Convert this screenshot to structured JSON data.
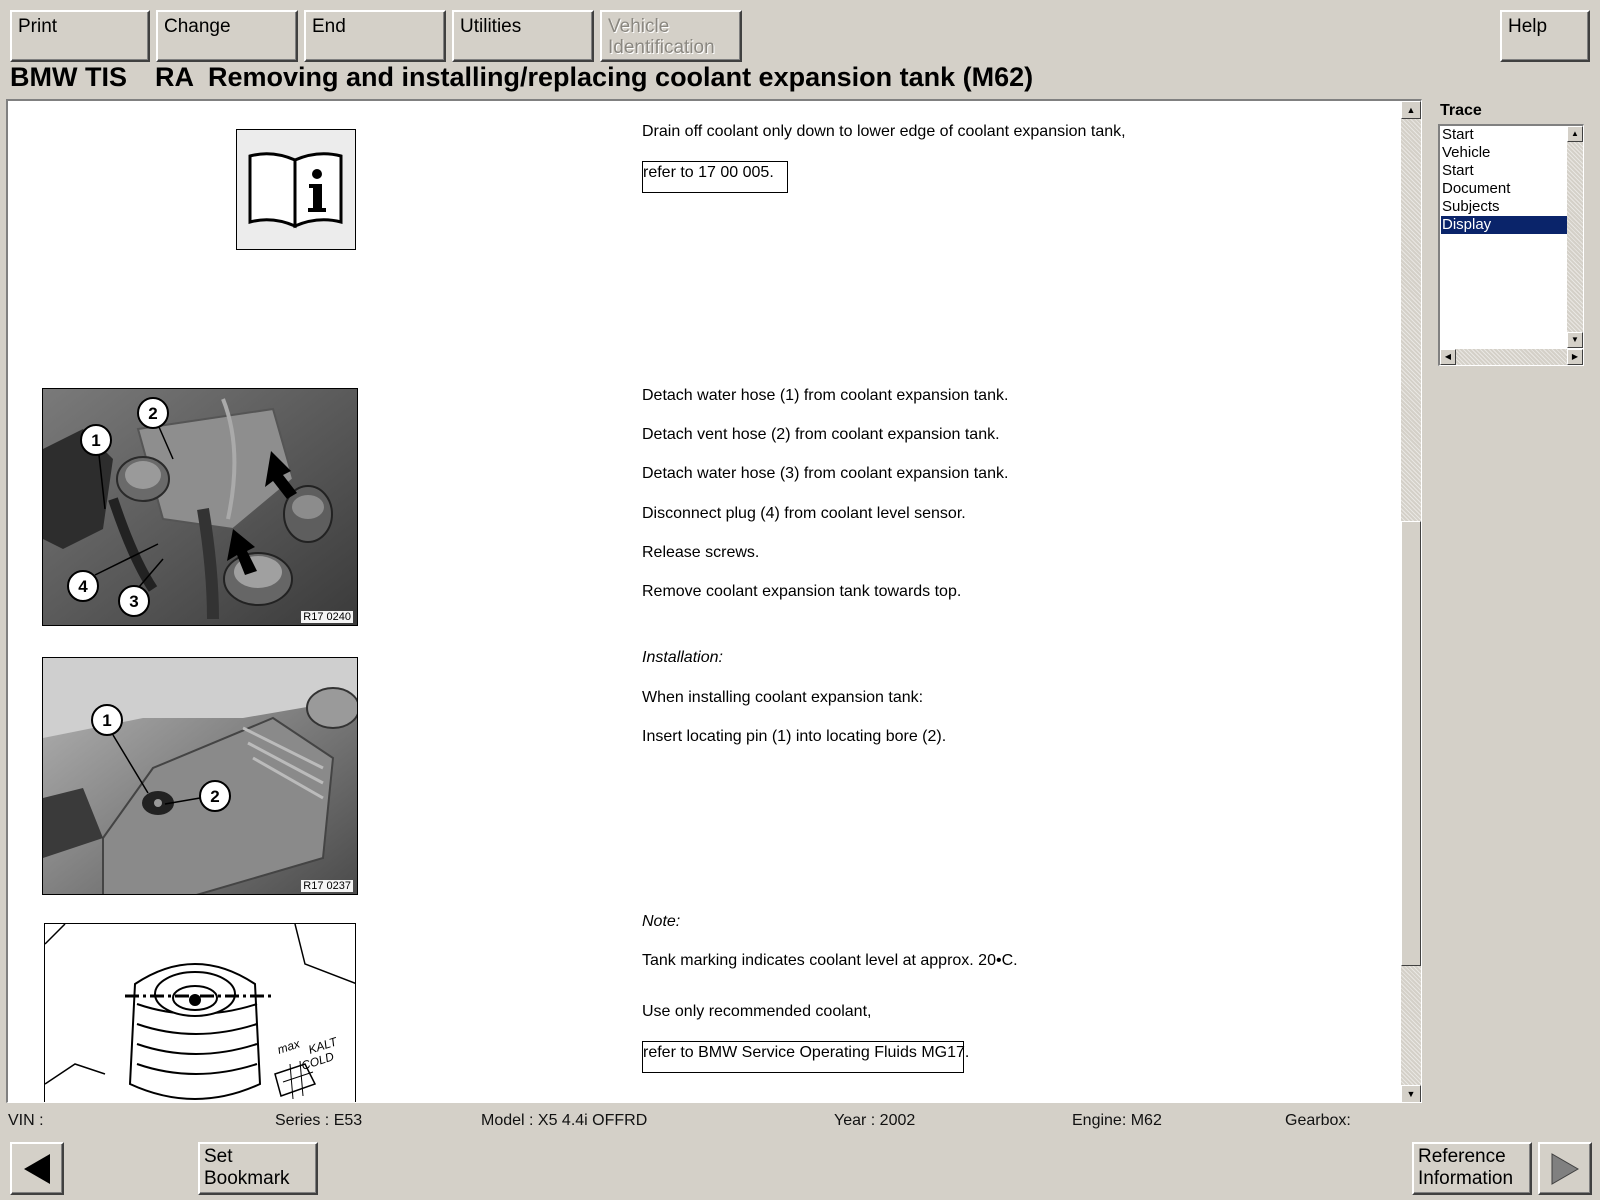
{
  "toolbar": {
    "print": "Print",
    "change": "Change",
    "end": "End",
    "utilities": "Utilities",
    "vehicle_id_line1": "Vehicle",
    "vehicle_id_line2": "Identification",
    "help": "Help"
  },
  "header": {
    "app": "BMW TIS",
    "doc_type": "RA",
    "doc_title": "Removing and installing/replacing coolant expansion tank (M62)"
  },
  "document": {
    "step1": {
      "icon": "info-book-icon",
      "text": "Drain off coolant only down to lower edge of coolant expansion tank,",
      "link": "refer to 17 00 005."
    },
    "step2": {
      "image_ref": "R17 0240",
      "callouts": [
        "1",
        "2",
        "3",
        "4"
      ],
      "lines": [
        "Detach water hose (1) from coolant expansion tank.",
        "Detach vent hose (2) from coolant expansion tank.",
        "Detach water hose (3) from coolant expansion tank.",
        "Disconnect plug (4) from coolant level sensor.",
        "Release screws.",
        "Remove coolant expansion tank towards top."
      ]
    },
    "step3": {
      "image_ref": "R17 0237",
      "callouts": [
        "1",
        "2"
      ],
      "heading": "Installation:",
      "lines": [
        "When installing coolant expansion tank:",
        "Insert locating pin (1) into locating bore (2)."
      ]
    },
    "step4": {
      "image_labels": [
        "max",
        "KALT",
        "COLD"
      ],
      "heading": "Note:",
      "line1": "Tank marking indicates coolant level at approx. 20•C.",
      "line2": "Use only recommended coolant,",
      "link": "refer to BMW Service Operating Fluids MG17."
    }
  },
  "trace": {
    "label": "Trace",
    "items": [
      "Start",
      "Vehicle",
      "Start",
      "Document",
      "Subjects",
      "Display"
    ],
    "selected": "Display"
  },
  "status": {
    "vin": "VIN :",
    "series": "Series : E53",
    "model": "Model : X5 4.4i OFFRD",
    "year": "Year : 2002",
    "engine": "Engine: M62",
    "gearbox": "Gearbox:"
  },
  "bottom": {
    "set_bookmark_line1": "Set",
    "set_bookmark_line2": "Bookmark",
    "ref_info_line1": "Reference",
    "ref_info_line2": "Information",
    "back_icon": "arrow-left-icon",
    "forward_icon": "arrow-right-icon"
  }
}
